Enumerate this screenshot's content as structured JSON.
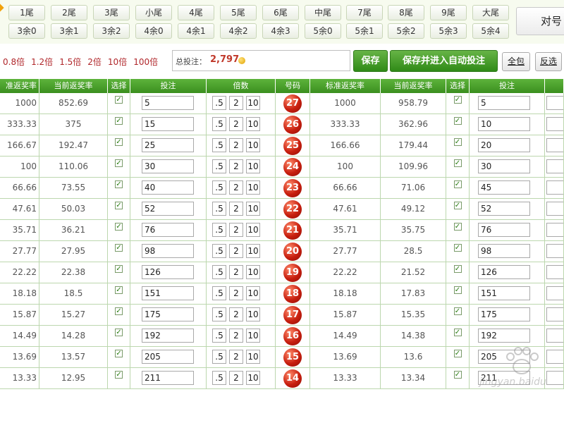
{
  "quick_buttons": {
    "row1": [
      "1尾",
      "2尾",
      "3尾",
      "小尾",
      "4尾",
      "5尾",
      "6尾",
      "中尾",
      "7尾",
      "8尾",
      "9尾",
      "大尾"
    ],
    "row2": [
      "3余0",
      "3余1",
      "3余2",
      "4余0",
      "4余1",
      "4余2",
      "4余3",
      "5余0",
      "5余1",
      "5余2",
      "5余3",
      "5余4"
    ],
    "side_button": "对号"
  },
  "multipliers": [
    "0.8倍",
    "1.2倍",
    "1.5倍",
    "2倍",
    "10倍",
    "100倍"
  ],
  "total": {
    "label": "总投注：",
    "value": "2,797"
  },
  "actions": {
    "save": "保存",
    "save_auto": "保存并进入自动投注",
    "all": "全包",
    "invert": "反选"
  },
  "headers": [
    "准返奖率",
    "当前返奖率",
    "选择",
    "投注",
    "倍数",
    "号码",
    "标准返奖率",
    "当前返奖率",
    "选择",
    "投注"
  ],
  "multiplier_buttons": [
    ".5",
    "2",
    "10"
  ],
  "rows": [
    {
      "std1": "1000",
      "cur1": "852.69",
      "bet1": "5",
      "num": "27",
      "std2": "1000",
      "cur2": "958.79",
      "bet2": "5"
    },
    {
      "std1": "333.33",
      "cur1": "375",
      "bet1": "15",
      "num": "26",
      "std2": "333.33",
      "cur2": "362.96",
      "bet2": "10"
    },
    {
      "std1": "166.67",
      "cur1": "192.47",
      "bet1": "25",
      "num": "25",
      "std2": "166.66",
      "cur2": "179.44",
      "bet2": "20"
    },
    {
      "std1": "100",
      "cur1": "110.06",
      "bet1": "30",
      "num": "24",
      "std2": "100",
      "cur2": "109.96",
      "bet2": "30"
    },
    {
      "std1": "66.66",
      "cur1": "73.55",
      "bet1": "40",
      "num": "23",
      "std2": "66.66",
      "cur2": "71.06",
      "bet2": "45"
    },
    {
      "std1": "47.61",
      "cur1": "50.03",
      "bet1": "52",
      "num": "22",
      "std2": "47.61",
      "cur2": "49.12",
      "bet2": "52"
    },
    {
      "std1": "35.71",
      "cur1": "36.21",
      "bet1": "76",
      "num": "21",
      "std2": "35.71",
      "cur2": "35.75",
      "bet2": "76"
    },
    {
      "std1": "27.77",
      "cur1": "27.95",
      "bet1": "98",
      "num": "20",
      "std2": "27.77",
      "cur2": "28.5",
      "bet2": "98"
    },
    {
      "std1": "22.22",
      "cur1": "22.38",
      "bet1": "126",
      "num": "19",
      "std2": "22.22",
      "cur2": "21.52",
      "bet2": "126"
    },
    {
      "std1": "18.18",
      "cur1": "18.5",
      "bet1": "151",
      "num": "18",
      "std2": "18.18",
      "cur2": "17.83",
      "bet2": "151"
    },
    {
      "std1": "15.87",
      "cur1": "15.27",
      "bet1": "175",
      "num": "17",
      "std2": "15.87",
      "cur2": "15.35",
      "bet2": "175"
    },
    {
      "std1": "14.49",
      "cur1": "14.28",
      "bet1": "192",
      "num": "16",
      "std2": "14.49",
      "cur2": "14.38",
      "bet2": "192"
    },
    {
      "std1": "13.69",
      "cur1": "13.57",
      "bet1": "205",
      "num": "15",
      "std2": "13.69",
      "cur2": "13.6",
      "bet2": "205"
    },
    {
      "std1": "13.33",
      "cur1": "12.95",
      "bet1": "211",
      "num": "14",
      "std2": "13.33",
      "cur2": "13.34",
      "bet2": "211"
    }
  ],
  "watermark": "jingyan.baidu",
  "colors": {
    "header_green": "#4ba12d",
    "ball_red": "#c81f0f",
    "accent_red": "#b0262a",
    "button_green": "#3a9120"
  }
}
